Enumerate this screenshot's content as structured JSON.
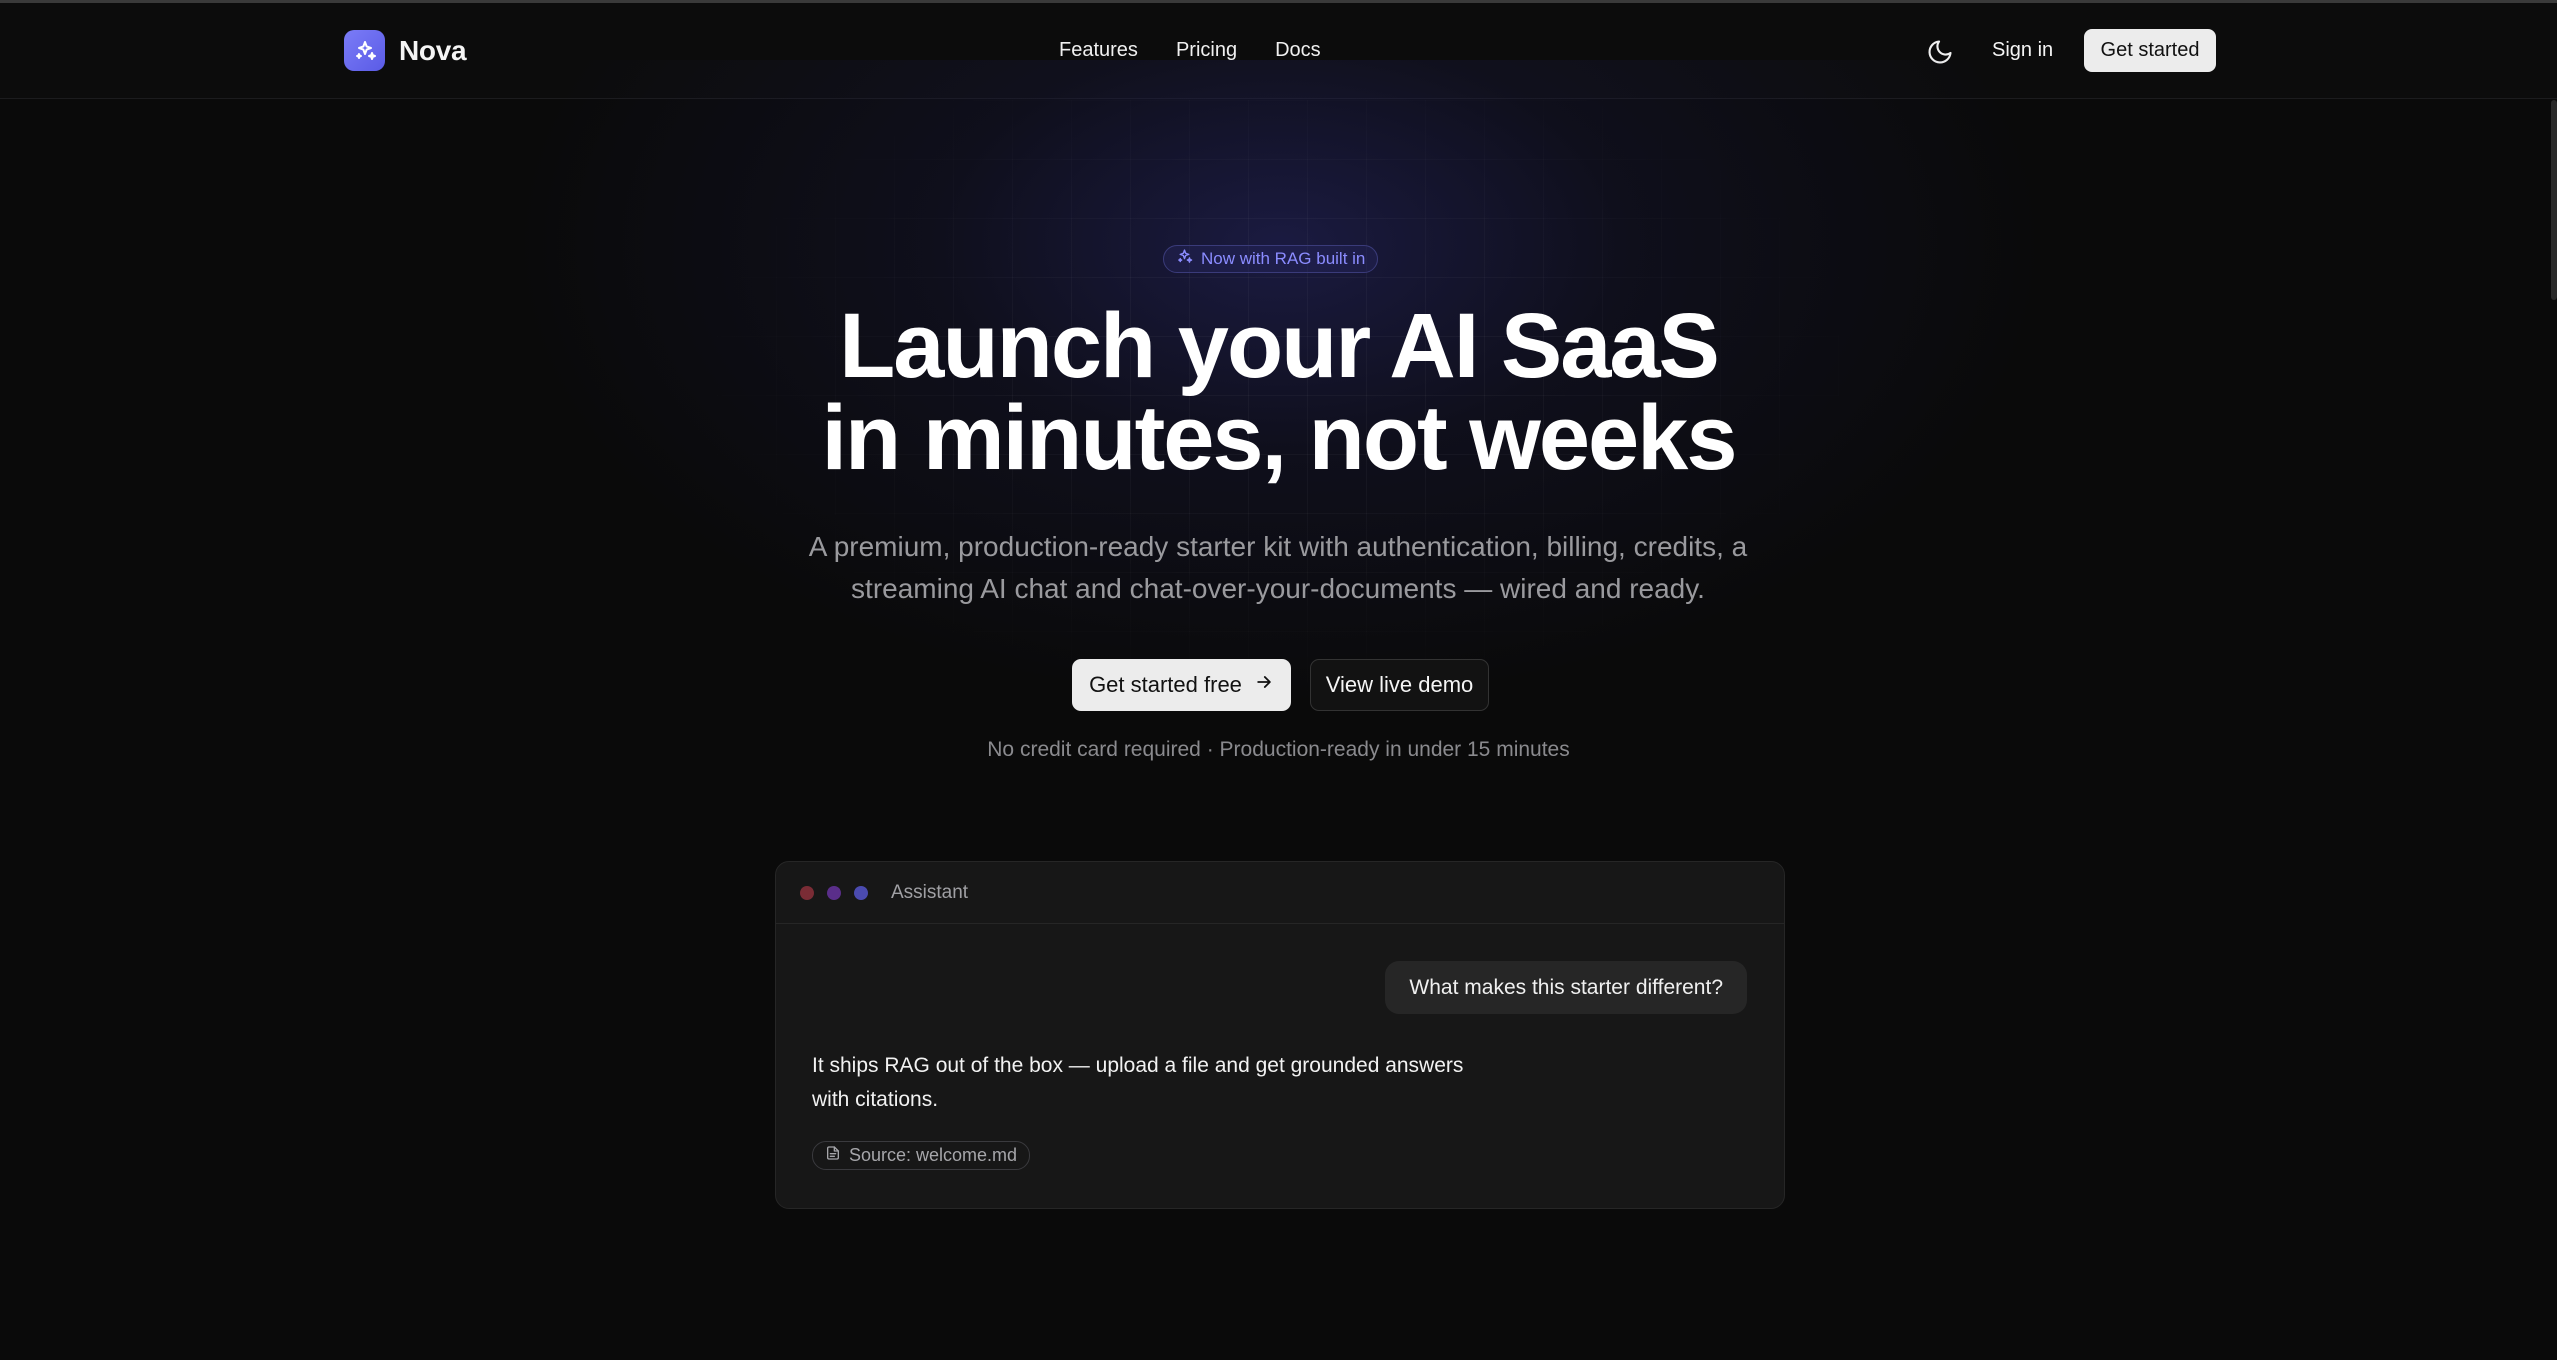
{
  "header": {
    "brand": "Nova",
    "nav": [
      "Features",
      "Pricing",
      "Docs"
    ],
    "theme_toggle_icon": "moon-icon",
    "sign_in": "Sign in",
    "cta": "Get started"
  },
  "hero": {
    "badge": "Now with RAG built in",
    "headline_line1": "Launch your AI SaaS",
    "headline_line2": "in minutes, not weeks",
    "subtitle_line1": "A premium, production-ready starter kit with authentication, billing, credits, a",
    "subtitle_line2": "streaming AI chat and chat-over-your-documents — wired and ready.",
    "primary_cta": "Get started free",
    "secondary_cta": "View live demo",
    "note": "No credit card required · Production-ready in under 15 minutes"
  },
  "chat_card": {
    "title": "Assistant",
    "user_message": "What makes this starter different?",
    "assistant_line1": "It ships RAG out of the box — upload a file and get grounded answers",
    "assistant_line2": "with citations.",
    "source": "Source: welcome.md",
    "dot_colors": [
      "#7a2c35",
      "#5a2e8a",
      "#4b4bb0"
    ]
  },
  "colors": {
    "accent": "#6366f1",
    "background": "#0a0a0a"
  }
}
